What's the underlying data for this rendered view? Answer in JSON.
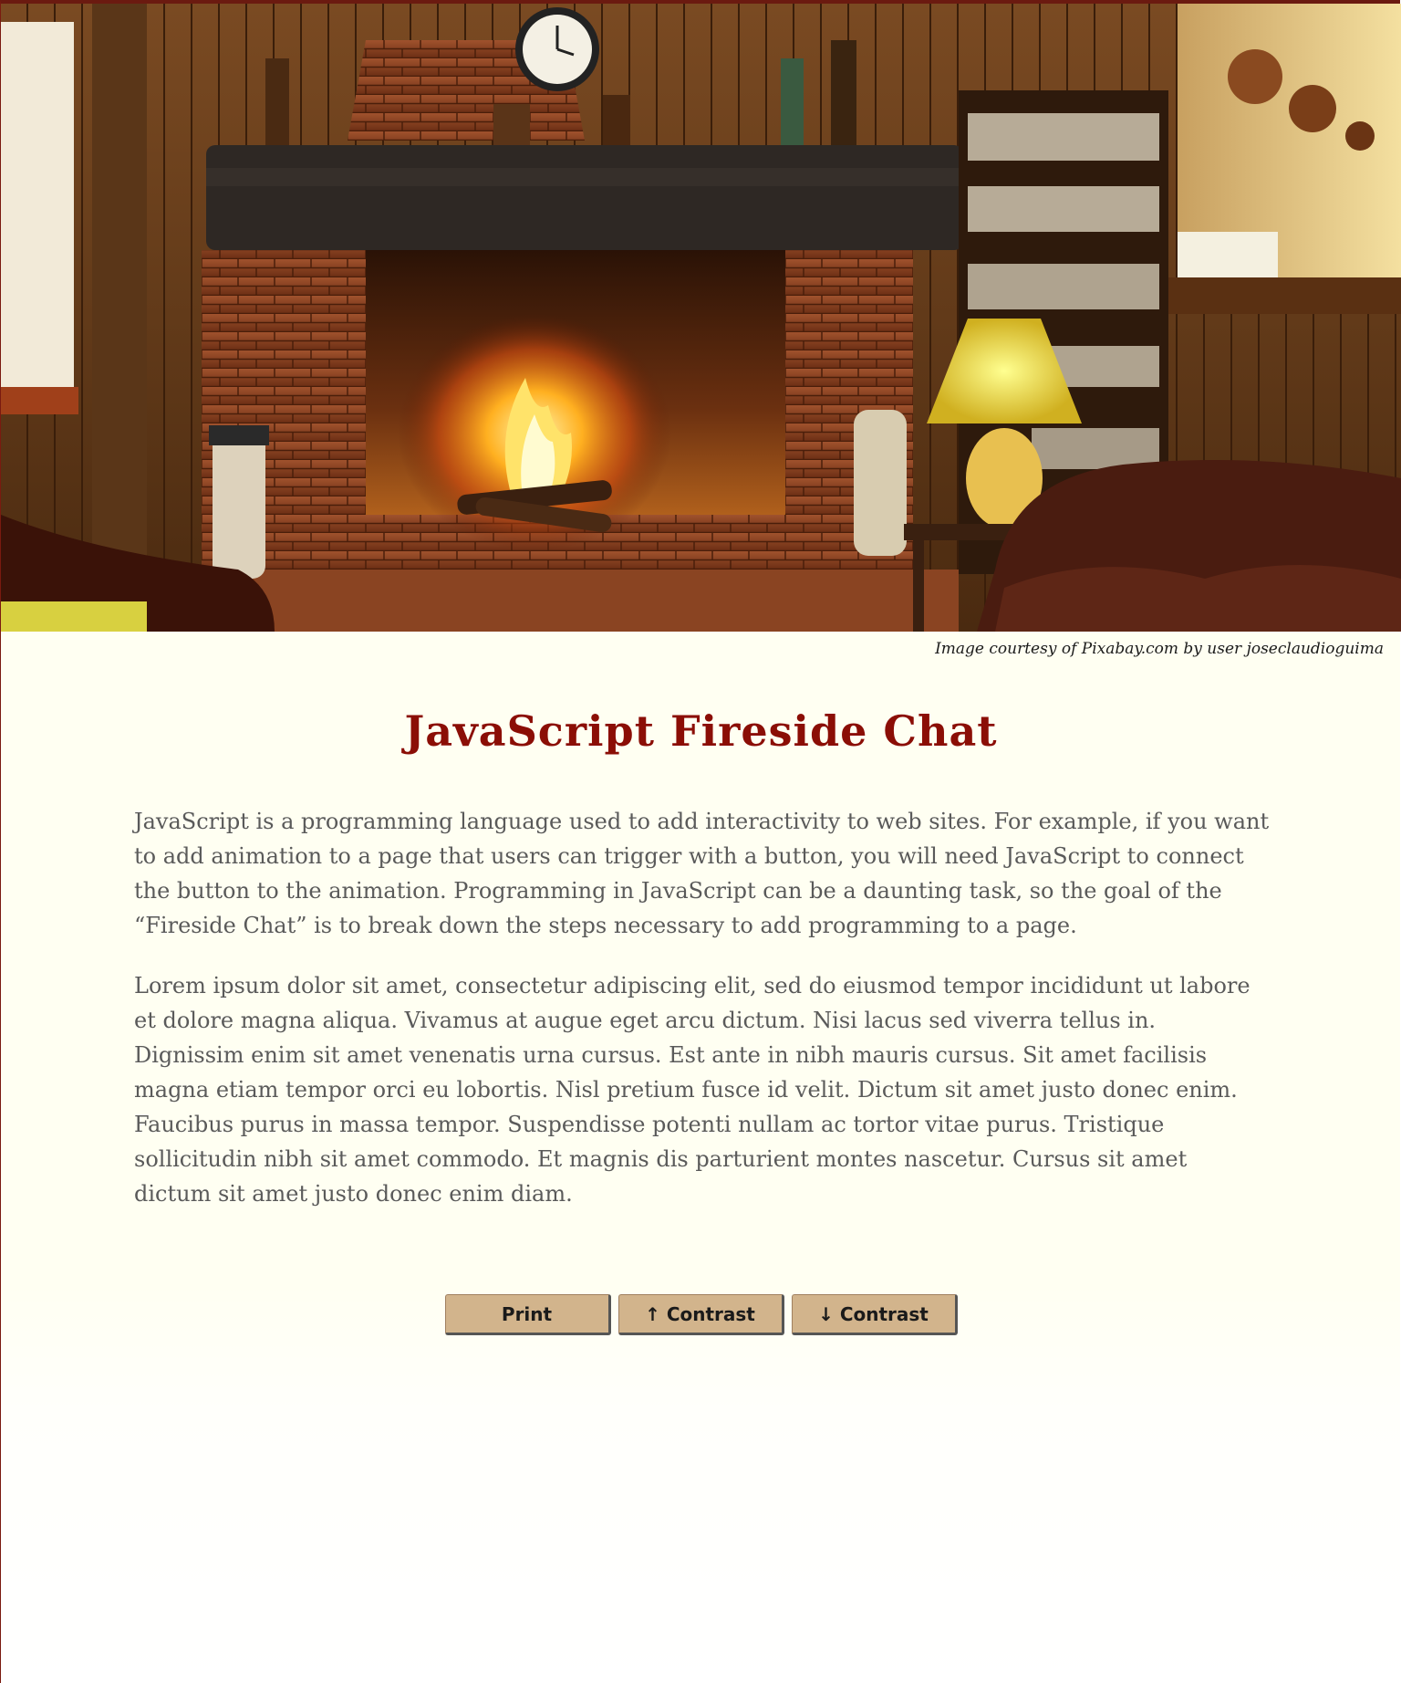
{
  "hero": {
    "image_alt": "Rustic cabin room with a lit brick fireplace, wooden mantel, lamp, glass shelves and leather sofa"
  },
  "credit": {
    "prefix": "Image courtesy of ",
    "source": "Pixabay.com",
    "middle": " by user ",
    "user": "joseclaudioguima"
  },
  "title": "JavaScript Fireside Chat",
  "paragraphs": [
    "JavaScript is a programming language used to add interactivity to web sites. For example, if you want to add animation to a page that users can trigger with a button, you will need JavaScript to connect the button to the animation. Programming in JavaScript can be a daunting task, so the goal of the “Fireside Chat” is to break down the steps necessary to add programming to a page.",
    "Lorem ipsum dolor sit amet, consectetur adipiscing elit, sed do eiusmod tempor incididunt ut labore et dolore magna aliqua. Vivamus at augue eget arcu dictum. Nisi lacus sed viverra tellus in. Dignissim enim sit amet venenatis urna cursus. Est ante in nibh mauris cursus. Sit amet facilisis magna etiam tempor orci eu lobortis. Nisl pretium fusce id velit. Dictum sit amet justo donec enim. Faucibus purus in massa tempor. Suspendisse potenti nullam ac tortor vitae purus. Tristique sollicitudin nibh sit amet commodo. Et magnis dis parturient montes nascetur. Cursus sit amet dictum sit amet justo donec enim diam."
  ],
  "buttons": {
    "print": "Print",
    "contrast_up": "↑ Contrast",
    "contrast_down": "↓ Contrast"
  },
  "colors": {
    "title": "#8b0e06",
    "body_text": "#5a5a5a",
    "button_bg": "#d2b48c",
    "page_bg": "#fffff2",
    "border": "#6b1a10"
  }
}
